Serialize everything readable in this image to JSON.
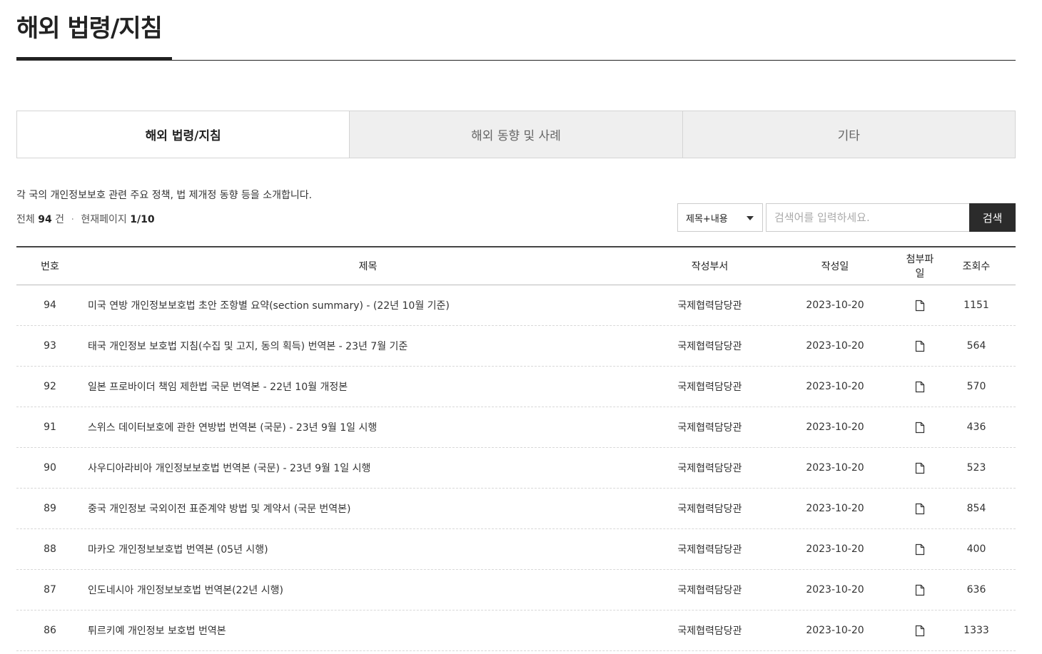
{
  "page": {
    "title": "해외 법령/지침",
    "description": "각 국의 개인정보보호 관련 주요 정책, 법 제개정 동향 등을 소개합니다."
  },
  "tabs": [
    {
      "label": "해외 법령/지침",
      "active": true
    },
    {
      "label": "해외 동향 및 사례",
      "active": false
    },
    {
      "label": "기타",
      "active": false
    }
  ],
  "summary": {
    "total_prefix": "전체",
    "total": "94",
    "total_unit": "건",
    "dot": "·",
    "page_prefix": "현재페이지",
    "page": "1/10"
  },
  "search": {
    "select_value": "제목+내용",
    "placeholder": "검색어를 입력하세요.",
    "button_label": "검색"
  },
  "table": {
    "headers": {
      "num": "번호",
      "title": "제목",
      "dept": "작성부서",
      "date": "작성일",
      "file": "첨부파일",
      "views": "조회수"
    },
    "rows": [
      {
        "num": "94",
        "title": "미국 연방 개인정보보호법 초안 조항별 요약(section summary) - (22년 10월 기준)",
        "dept": "국제협력담당관",
        "date": "2023-10-20",
        "file_icon": "document-icon",
        "views": "1151"
      },
      {
        "num": "93",
        "title": "태국 개인정보 보호법 지침(수집 및 고지, 동의 획득) 번역본 - 23년 7월 기준",
        "dept": "국제협력담당관",
        "date": "2023-10-20",
        "file_icon": "document-icon",
        "views": "564"
      },
      {
        "num": "92",
        "title": "일본 프로바이더 책임 제한법 국문 번역본 - 22년 10월 개정본",
        "dept": "국제협력담당관",
        "date": "2023-10-20",
        "file_icon": "document-icon",
        "views": "570"
      },
      {
        "num": "91",
        "title": "스위스 데이터보호에 관한 연방법 번역본 (국문) - 23년 9월 1일 시행",
        "dept": "국제협력담당관",
        "date": "2023-10-20",
        "file_icon": "document-icon",
        "views": "436"
      },
      {
        "num": "90",
        "title": "사우디아라비아 개인정보보호법 번역본 (국문) - 23년 9월 1일 시행",
        "dept": "국제협력담당관",
        "date": "2023-10-20",
        "file_icon": "document-icon",
        "views": "523"
      },
      {
        "num": "89",
        "title": "중국 개인정보 국외이전 표준계약 방법 및 계약서 (국문 번역본)",
        "dept": "국제협력담당관",
        "date": "2023-10-20",
        "file_icon": "document-icon",
        "views": "854"
      },
      {
        "num": "88",
        "title": "마카오 개인정보보호법 번역본 (05년 시행)",
        "dept": "국제협력담당관",
        "date": "2023-10-20",
        "file_icon": "document-icon",
        "views": "400"
      },
      {
        "num": "87",
        "title": "인도네시아 개인정보보호법 번역본(22년 시행)",
        "dept": "국제협력담당관",
        "date": "2023-10-20",
        "file_icon": "document-icon",
        "views": "636"
      },
      {
        "num": "86",
        "title": "튀르키예 개인정보 보호법 번역본",
        "dept": "국제협력담당관",
        "date": "2023-10-20",
        "file_icon": "document-icon",
        "views": "1333"
      }
    ]
  }
}
